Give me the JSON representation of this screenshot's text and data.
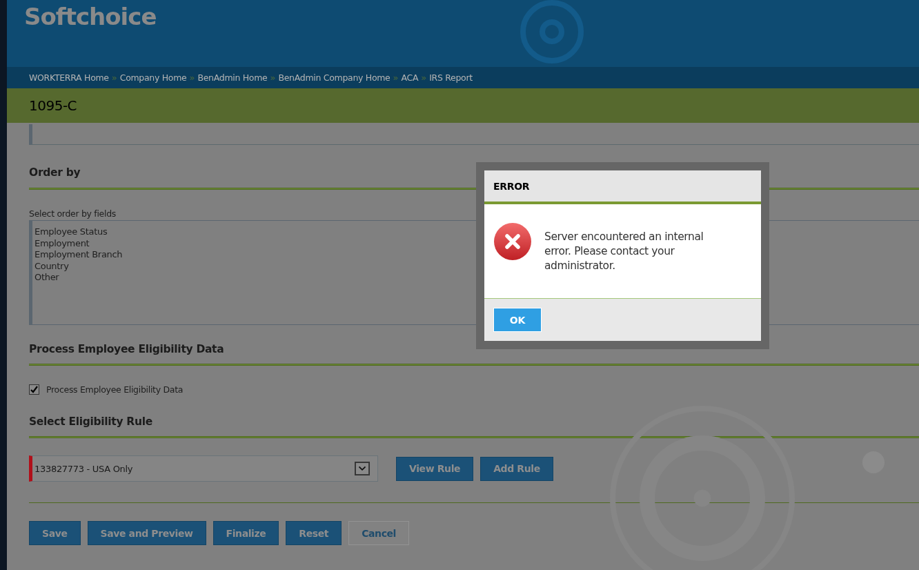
{
  "app": {
    "logo": "Softchoice"
  },
  "breadcrumbs": {
    "separator": "»",
    "items": [
      "WORKTERRA Home",
      "Company Home",
      "BenAdmin Home",
      "BenAdmin Company Home",
      "ACA",
      "IRS Report"
    ]
  },
  "page_title": "1095-C",
  "order_by": {
    "heading": "Order by",
    "label": "Select order by fields",
    "options": [
      "Employee Status",
      "Employment",
      "Employment Branch",
      "Country",
      "Other"
    ]
  },
  "eligibility": {
    "heading": "Process Employee Eligibility Data",
    "checkbox": {
      "label": "Process Employee Eligibility Data",
      "checked": true
    }
  },
  "rule": {
    "heading": "Select Eligibility Rule",
    "select": {
      "value": "133827773 - USA Only",
      "required": true
    },
    "buttons": [
      "View Rule",
      "Add Rule"
    ]
  },
  "actions": [
    {
      "label": "Save",
      "disabled": false
    },
    {
      "label": "Save and Preview",
      "disabled": false
    },
    {
      "label": "Finalize",
      "disabled": false
    },
    {
      "label": "Reset",
      "disabled": false
    },
    {
      "label": "Cancel",
      "disabled": true
    }
  ],
  "dialog": {
    "title": "ERROR",
    "message": "Server encountered an internal error. Please contact your administrator.",
    "buttons": [
      "OK"
    ]
  }
}
